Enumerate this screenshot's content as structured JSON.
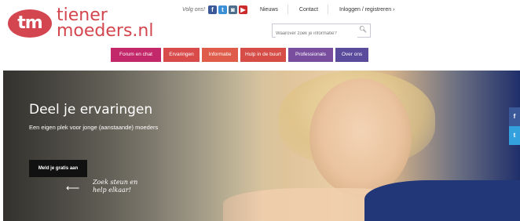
{
  "logo": {
    "badge": "tm",
    "line1": "tiener",
    "line2": "moeders.nl"
  },
  "topbar": {
    "follow_label": "Volg ons!",
    "social": [
      {
        "icon": "facebook-icon",
        "glyph": "f"
      },
      {
        "icon": "twitter-icon",
        "glyph": "t"
      },
      {
        "icon": "instagram-icon",
        "glyph": "◙"
      },
      {
        "icon": "youtube-icon",
        "glyph": "▶"
      }
    ],
    "links": [
      "Nieuws",
      "Contact",
      "Inloggen / registreren ›"
    ]
  },
  "search": {
    "placeholder": "Waarover zoek je informatie?",
    "icon": "search-icon"
  },
  "nav": [
    {
      "label": "Forum en chat",
      "color": "#c3286a"
    },
    {
      "label": "Ervaringen",
      "color": "#d94b4b"
    },
    {
      "label": "Informatie",
      "color": "#e05c4a"
    },
    {
      "label": "Hulp in de buurt",
      "color": "#d64c46"
    },
    {
      "label": "Professionals",
      "color": "#7a4e9e"
    },
    {
      "label": "Over ons",
      "color": "#5b4b9c"
    }
  ],
  "hero": {
    "title": "Deel je ervaringen",
    "subtitle": "Een eigen plek voor jonge (aanstaande) moeders",
    "cta": "Meld je gratis aan",
    "handwritten_line1": "Zoek steun en",
    "handwritten_line2": "help elkaar!"
  },
  "side_share": [
    {
      "icon": "facebook-icon",
      "glyph": "f"
    },
    {
      "icon": "twitter-icon",
      "glyph": "t"
    }
  ]
}
